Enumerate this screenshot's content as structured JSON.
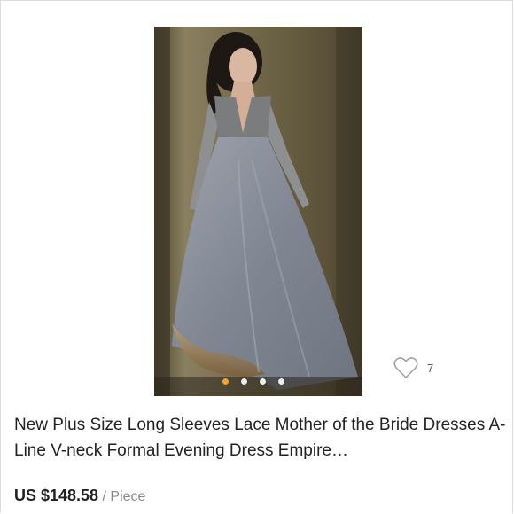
{
  "product": {
    "title": "New Plus Size Long Sleeves Lace Mother of the Bride Dresses A-Line V-neck Formal Evening Dress Empire…",
    "price": "US $148.58",
    "separator": " / ",
    "unit": "Piece",
    "wishlist_count": "7",
    "wishlist_icon": "heart-outline-icon",
    "image": {
      "subject": "product-photo",
      "carousel_total": 4,
      "carousel_active_index": 0
    }
  },
  "colors": {
    "accent_dot": "#f5a623",
    "price_text": "#222222",
    "unit_text": "#888888",
    "heart_stroke": "#999999"
  }
}
